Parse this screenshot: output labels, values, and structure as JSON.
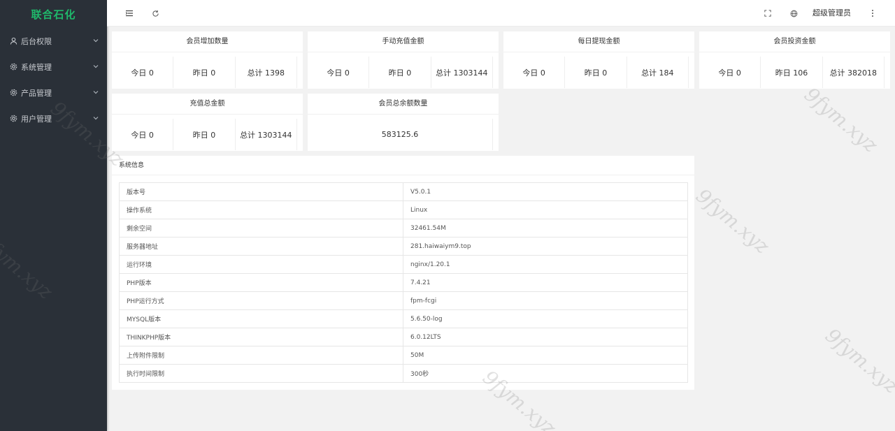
{
  "brand": {
    "name": "联合石化",
    "color": "#1fb86b"
  },
  "sidebar": {
    "items": [
      {
        "label": "后台权限",
        "icon": "user-icon"
      },
      {
        "label": "系统管理",
        "icon": "gear-icon"
      },
      {
        "label": "产品管理",
        "icon": "gear-icon"
      },
      {
        "label": "用户管理",
        "icon": "gear-icon"
      }
    ]
  },
  "header": {
    "admin_name": "超级管理员",
    "icons": [
      "menu-toggle-icon",
      "refresh-icon",
      "fullscreen-icon",
      "globe-icon",
      "more-vertical-icon"
    ]
  },
  "stats": [
    {
      "title": "会员增加数量",
      "cells": [
        "今日 0",
        "昨日 0",
        "总计 1398"
      ]
    },
    {
      "title": "手动充值金额",
      "cells": [
        "今日 0",
        "昨日 0",
        "总计 1303144"
      ]
    },
    {
      "title": "每日提现金额",
      "cells": [
        "今日 0",
        "昨日 0",
        "总计 184"
      ]
    },
    {
      "title": "会员投资金额",
      "cells": [
        "今日 0",
        "昨日 106",
        "总计 382018"
      ]
    },
    {
      "title": "充值总金额",
      "cells": [
        "今日 0",
        "昨日 0",
        "总计 1303144"
      ]
    },
    {
      "title": "会员总余额数量",
      "cells": [
        "583125.6"
      ]
    }
  ],
  "sysinfo": {
    "title": "系统信息",
    "rows": [
      {
        "key": "版本号",
        "value": "V5.0.1"
      },
      {
        "key": "操作系统",
        "value": "Linux"
      },
      {
        "key": "剩余空间",
        "value": "32461.54M"
      },
      {
        "key": "服务器地址",
        "value": "281.haiwaiym9.top"
      },
      {
        "key": "运行环境",
        "value": "nginx/1.20.1"
      },
      {
        "key": "PHP版本",
        "value": "7.4.21"
      },
      {
        "key": "PHP运行方式",
        "value": "fpm-fcgi"
      },
      {
        "key": "MYSQL版本",
        "value": "5.6.50-log"
      },
      {
        "key": "THINKPHP版本",
        "value": "6.0.12LTS"
      },
      {
        "key": "上传附件限制",
        "value": "50M"
      },
      {
        "key": "执行时间限制",
        "value": "300秒"
      }
    ]
  },
  "watermark": {
    "text": "9fym.xyz"
  }
}
